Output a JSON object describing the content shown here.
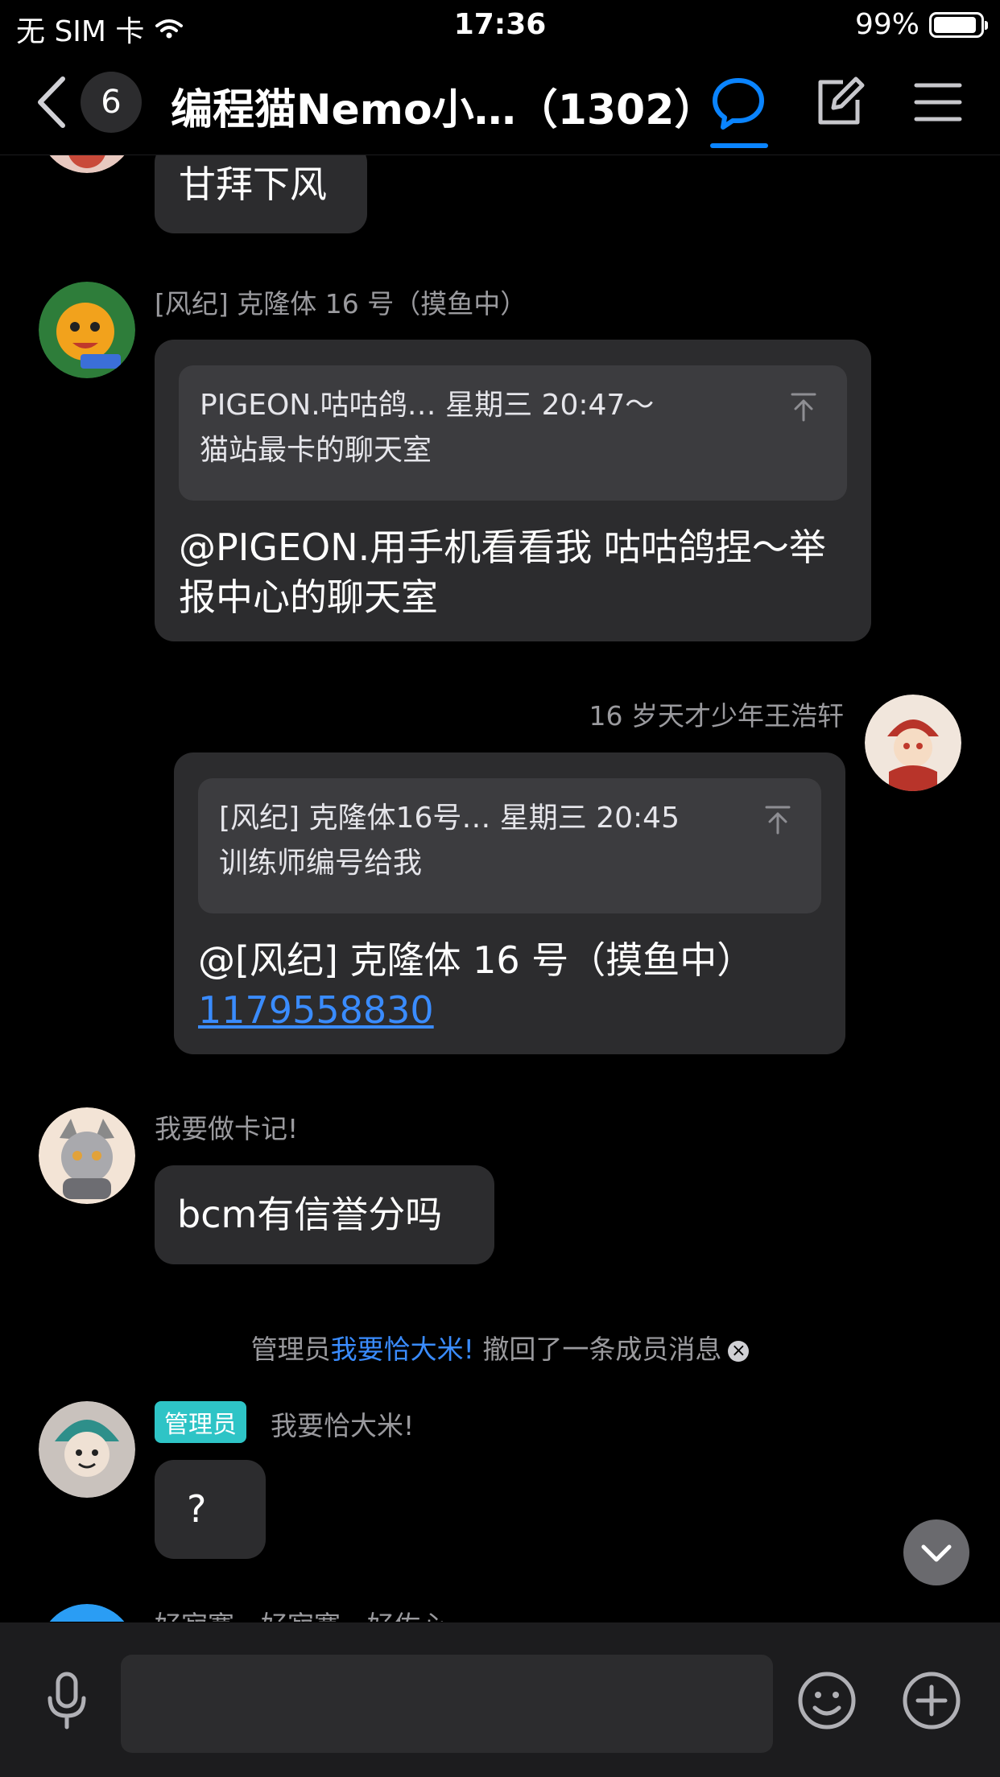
{
  "status_bar": {
    "carrier": "无 SIM 卡",
    "time": "17:36",
    "battery": "99%",
    "battery_level": 0.99
  },
  "nav": {
    "unread_count": "6",
    "title": "编程猫Nemo小…（1302）",
    "icons": [
      "back-chevron-icon",
      "chat-bubble-icon",
      "edit-icon",
      "menu-icon"
    ],
    "accent_color": "#0a84ff"
  },
  "messages": [
    {
      "bubble_text": "甘拜下风"
    },
    {
      "sender": "[风纪] 克隆体 16 号（摸鱼中）",
      "quote_header": "PIGEON.咕咕鸽… 星期三 20:47～",
      "quote_body": "猫站最卡的聊天室",
      "text": "@PIGEON.用手机看看我 咕咕鸽捏～举报中心的聊天室"
    },
    {
      "sender": "16 岁天才少年王浩轩",
      "quote_header": "[风纪] 克隆体16号… 星期三 20:45",
      "quote_body": "训练师编号给我",
      "text": "@[风纪] 克隆体 16 号（摸鱼中）",
      "link": "1179558830"
    },
    {
      "sender": "我要做卡记!",
      "text": "bcm有信誉分吗"
    },
    {
      "sender": "我要恰大米!",
      "role": "管理员",
      "text": "?"
    },
    {
      "sender": "好寂寞，好寂寞，好佐心"
    }
  ],
  "system_message": {
    "prefix": "管理员",
    "name": "我要恰大米!",
    "suffix": "撤回了一条成员消息"
  },
  "input_bar": {
    "icons": [
      "microphone-icon",
      "emoji-icon",
      "add-icon"
    ],
    "placeholder": ""
  }
}
